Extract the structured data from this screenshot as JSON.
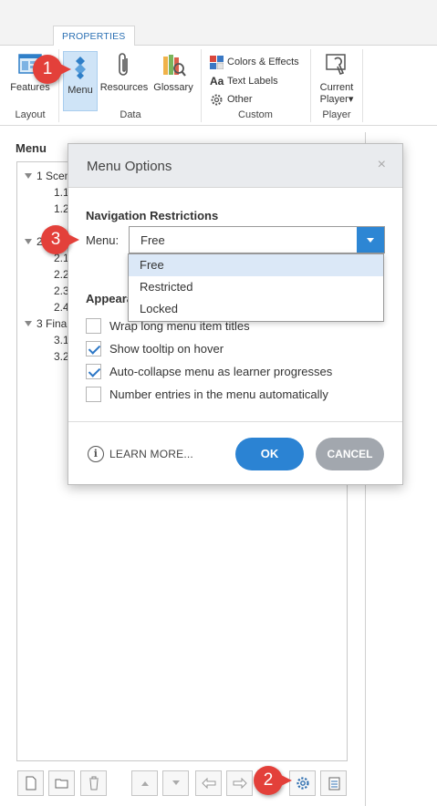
{
  "ribbon": {
    "tab": "PROPERTIES",
    "groups": {
      "layout": {
        "label": "Layout",
        "features": "Features"
      },
      "data": {
        "label": "Data",
        "menu": "Menu",
        "resources": "Resources",
        "glossary": "Glossary"
      },
      "custom": {
        "label": "Custom",
        "colors": "Colors & Effects",
        "text_labels": "Text Labels",
        "other": "Other",
        "text_labels_icon": "Aa"
      },
      "player": {
        "label": "Player",
        "current_line1": "Current",
        "current_line2": "Player▾"
      }
    }
  },
  "panel": {
    "title": "Menu",
    "tree": [
      {
        "label": "1 Scen",
        "level": 0
      },
      {
        "label": "1.1",
        "level": 1
      },
      {
        "label": "1.2",
        "level": 1
      },
      {
        "label": "2",
        "level": 0
      },
      {
        "label": "2.1",
        "level": 1
      },
      {
        "label": "2.2",
        "level": 1
      },
      {
        "label": "2.3",
        "level": 1
      },
      {
        "label": "2.4",
        "level": 1
      },
      {
        "label": "3 Fina",
        "level": 0
      },
      {
        "label": "3.1",
        "level": 1
      },
      {
        "label": "3.2",
        "level": 1
      }
    ]
  },
  "callouts": {
    "one": "1",
    "two": "2",
    "three": "3"
  },
  "dialog": {
    "title": "Menu Options",
    "close": "×",
    "nav_section": "Navigation Restrictions",
    "menu_label": "Menu:",
    "menu_value": "Free",
    "menu_options": [
      "Free",
      "Restricted",
      "Locked"
    ],
    "appearance_section": "Appeara",
    "checkboxes": [
      {
        "label": "Wrap long menu item titles",
        "checked": false
      },
      {
        "label": "Show tooltip on hover",
        "checked": true
      },
      {
        "label": "Auto-collapse menu as learner progresses",
        "checked": true
      },
      {
        "label": "Number entries in the menu automatically",
        "checked": false
      }
    ],
    "learn_more": "LEARN MORE...",
    "info_icon": "i",
    "ok": "OK",
    "cancel": "CANCEL"
  }
}
